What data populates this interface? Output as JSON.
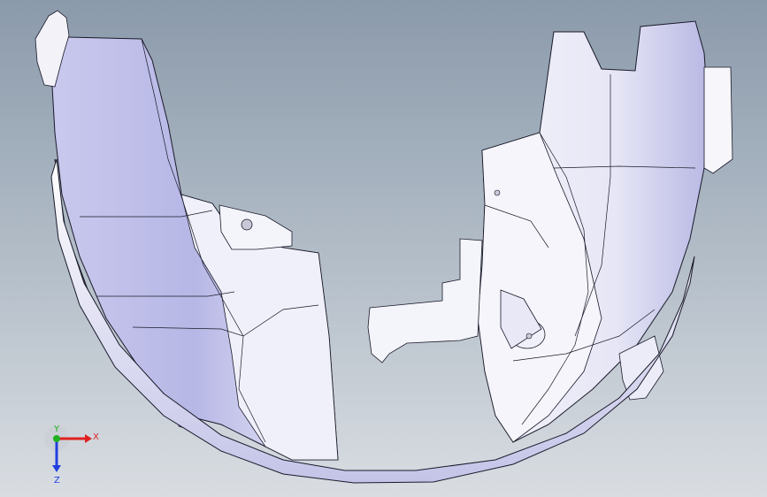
{
  "viewport": {
    "background_top": "#8b9aab",
    "background_bottom": "#d9dde2",
    "part_color": "#ebebf7",
    "part_shade": "#b9b9e6",
    "edge_color": "#1a1a2a",
    "accent_color": "#9b30d9"
  },
  "triad": {
    "x_label": "X",
    "y_label": "Y",
    "z_label": "Z",
    "x_color": "#e02020",
    "y_color": "#20b020",
    "z_color": "#2040e0"
  }
}
